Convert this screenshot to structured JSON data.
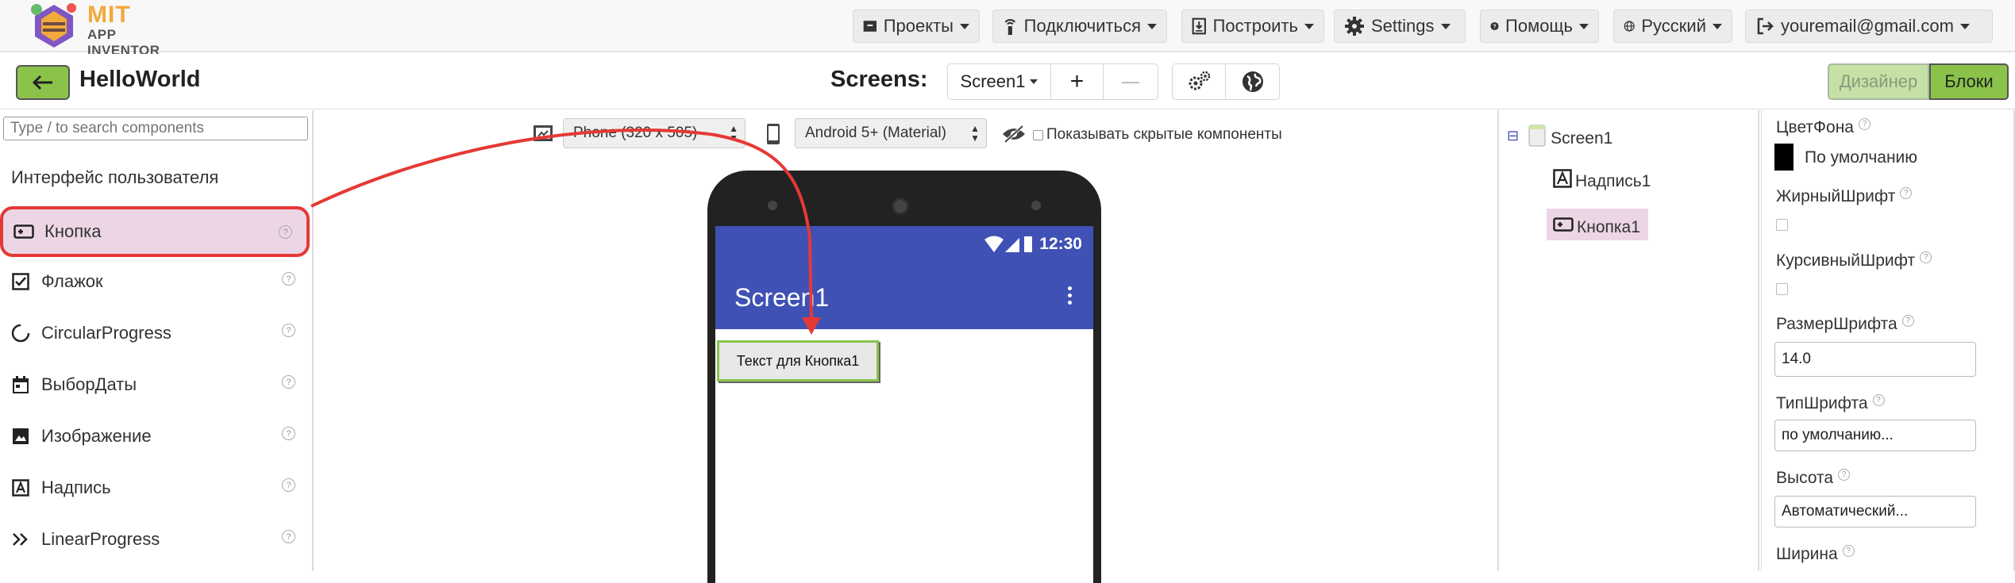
{
  "header": {
    "logo_top": "MIT",
    "logo_bottom": "APP INVENTOR",
    "menus": [
      {
        "label": "Проекты",
        "icon": "folder-icon"
      },
      {
        "label": "Подключиться",
        "icon": "antenna-icon"
      },
      {
        "label": "Построить",
        "icon": "build-icon"
      },
      {
        "label": "Settings",
        "icon": "gear-icon"
      },
      {
        "label": "Помощь",
        "icon": "help-icon"
      },
      {
        "label": "Русский",
        "icon": "globe-icon"
      },
      {
        "label": "youremail@gmail.com",
        "icon": "signout-icon"
      }
    ]
  },
  "project": {
    "name": "HelloWorld",
    "screens_label": "Screens:",
    "current_screen": "Screen1",
    "add_screen": "+",
    "remove_screen": "—",
    "designer_label": "Дизайнер",
    "blocks_label": "Блоки"
  },
  "palette": {
    "search_placeholder": "Type / to search components",
    "category": "Интерфейс пользователя",
    "items": [
      {
        "label": "Кнопка",
        "icon": "button-icon",
        "selected": true
      },
      {
        "label": "Флажок",
        "icon": "checkbox-icon"
      },
      {
        "label": "CircularProgress",
        "icon": "circular-progress-icon"
      },
      {
        "label": "ВыборДаты",
        "icon": "calendar-icon"
      },
      {
        "label": "Изображение",
        "icon": "image-icon"
      },
      {
        "label": "Надпись",
        "icon": "label-icon"
      },
      {
        "label": "LinearProgress",
        "icon": "linear-progress-icon"
      }
    ],
    "help_glyph": "?"
  },
  "viewer": {
    "device_select": "Phone (320 x 505)",
    "theme_select": "Android 5+ (Material)",
    "show_hidden_label": "Показывать скрытые компоненты",
    "phone": {
      "time": "12:30",
      "title": "Screen1",
      "button_text": "Текст для Кнопка1"
    }
  },
  "components_tree": {
    "collapse_glyph": "⊟",
    "root": "Screen1",
    "children": [
      {
        "label": "Надпись1",
        "icon": "label-icon"
      },
      {
        "label": "Кнопка1",
        "icon": "button-icon",
        "selected": true
      }
    ]
  },
  "properties": {
    "bg_color_label": "ЦветФона",
    "bg_color_value": "По умолчанию",
    "bold_label": "ЖирныйШрифт",
    "italic_label": "КурсивныйШрифт",
    "font_size_label": "РазмерШрифта",
    "font_size_value": "14.0",
    "font_type_label": "ТипШрифта",
    "font_type_value": "по умолчанию...",
    "height_label": "Высота",
    "height_value": "Автоматический...",
    "width_label": "Ширина",
    "help_glyph": "?"
  },
  "colors": {
    "accent_green": "#8bc34a",
    "app_bar": "#3f51b5",
    "selection_pink": "#ecd6e5",
    "highlight_red": "#e53935"
  }
}
